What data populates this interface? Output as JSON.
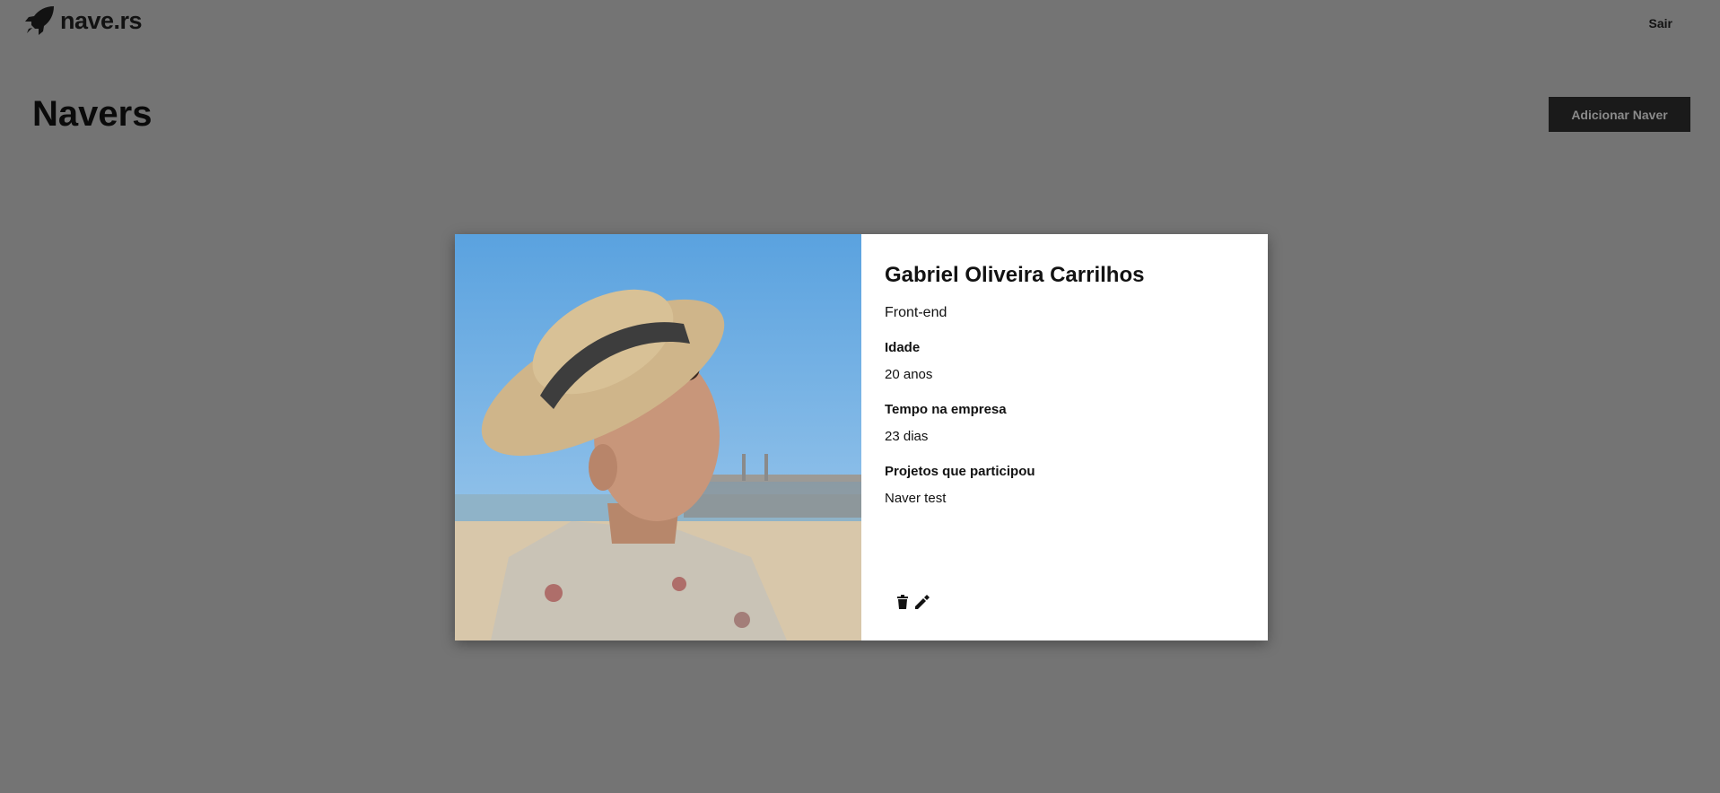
{
  "header": {
    "logo_text": "nave.rs",
    "logout_label": "Sair"
  },
  "page": {
    "title": "Navers",
    "add_button_label": "Adicionar Naver"
  },
  "modal": {
    "name": "Gabriel Oliveira Carrilhos",
    "role": "Front-end",
    "fields": [
      {
        "label": "Idade",
        "value": "20 anos"
      },
      {
        "label": "Tempo na empresa",
        "value": "23 dias"
      },
      {
        "label": "Projetos que participou",
        "value": "Naver test"
      }
    ],
    "actions": [
      "trash-icon",
      "pencil-icon"
    ]
  },
  "colors": {
    "overlay_background": "#747474",
    "button_background": "#1a1a1a",
    "text": "#121212"
  }
}
